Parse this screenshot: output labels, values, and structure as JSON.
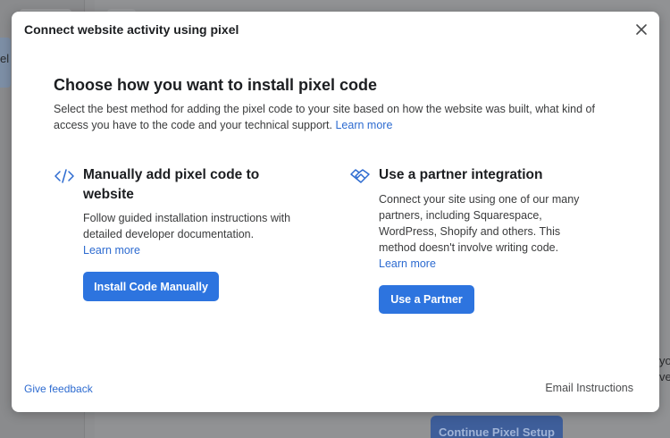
{
  "background": {
    "left_nav_partial_text": "el",
    "right_partial_lines": [
      "yo",
      "ve"
    ],
    "continue_button_label": "Continue Pixel Setup"
  },
  "modal": {
    "title": "Connect website activity using pixel",
    "close_icon": "close-icon",
    "heading": "Choose how you want to install pixel code",
    "description": "Select the best method for adding the pixel code to your site based on how the website was built, what kind of access you have to the code and your technical support.",
    "description_link": "Learn more",
    "options": {
      "manual": {
        "icon": "code-icon",
        "title": "Manually add pixel code to website",
        "description": "Follow guided installation instructions with detailed developer documentation.",
        "link": "Learn more",
        "button_label": "Install Code Manually"
      },
      "partner": {
        "icon": "handshake-icon",
        "title": "Use a partner integration",
        "description": "Connect your site using one of our many partners, including Squarespace, WordPress, Shopify and others. This method doesn't involve writing code.",
        "link": "Learn more",
        "button_label": "Use a Partner"
      }
    },
    "footer": {
      "feedback_link": "Give feedback",
      "email_instructions": "Email Instructions"
    }
  },
  "colors": {
    "accent": "#2d74df",
    "link": "#2d6bd0",
    "overlay": "#8e8f91"
  }
}
